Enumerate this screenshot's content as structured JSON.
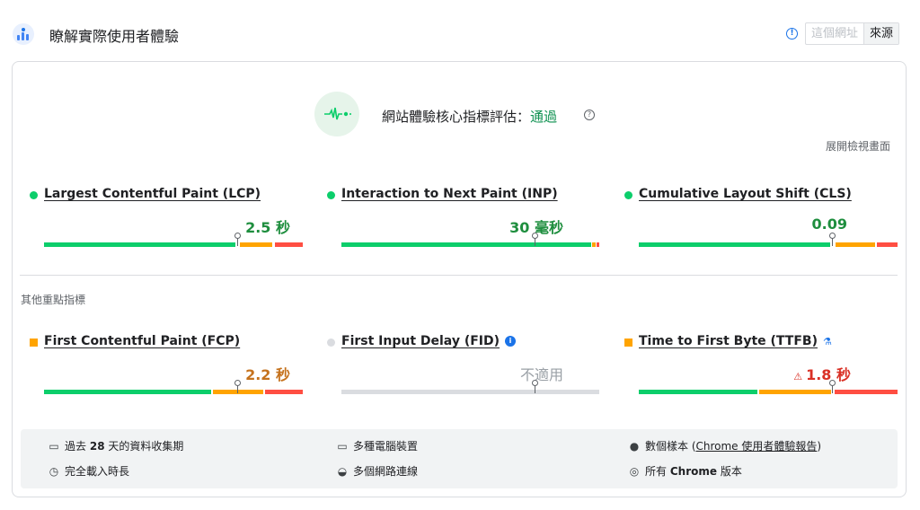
{
  "header": {
    "title": "瞭解實際使用者體驗",
    "tabs": [
      {
        "label": "這個網址",
        "active": false
      },
      {
        "label": "來源",
        "active": true
      }
    ]
  },
  "assessment": {
    "prefix": "網站體驗核心指標評估：",
    "result": "通過",
    "expand_label": "展開檢視畫面"
  },
  "core_metrics": [
    {
      "name": "Largest Contentful Paint (LCP)",
      "value": "2.5 秒",
      "status": "good",
      "good_pct": 75,
      "ni_pct": 13,
      "poor_pct": 12,
      "marker_pct": 75
    },
    {
      "name": "Interaction to Next Paint (INP)",
      "value": "30 毫秒",
      "status": "good",
      "good_pct": 97,
      "ni_pct": 2,
      "poor_pct": 1,
      "marker_pct": 75
    },
    {
      "name": "Cumulative Layout Shift (CLS)",
      "value": "0.09",
      "status": "good",
      "good_pct": 76,
      "ni_pct": 16,
      "poor_pct": 8,
      "marker_pct": 75
    }
  ],
  "other_label": "其他重點指標",
  "other_metrics": [
    {
      "name": "First Contentful Paint (FCP)",
      "value": "2.2 秒",
      "status": "ni",
      "good_pct": 65,
      "ni_pct": 20,
      "poor_pct": 15,
      "marker_pct": 75
    },
    {
      "name": "First Input Delay (FID)",
      "value": "不適用",
      "status": "na",
      "marker_pct": 75
    },
    {
      "name": "Time to First Byte (TTFB)",
      "value": "1.8 秒",
      "status": "poor",
      "good_pct": 46,
      "ni_pct": 29,
      "poor_pct": 25,
      "marker_pct": 75
    }
  ],
  "footer": {
    "period_prefix": "過去",
    "period_days": "28",
    "period_suffix": "天的資料收集期",
    "devices": "多種電腦裝置",
    "samples_prefix": "數個樣本 (",
    "samples_link": "Chrome 使用者體驗報告",
    "samples_suffix": ")",
    "load": "完全載入時長",
    "network": "多個網路連線",
    "versions_prefix": "所有",
    "versions_bold": "Chrome",
    "versions_suffix": "版本"
  },
  "icons": {
    "logo": "crux-logo-icon",
    "info": "info-icon",
    "assessment": "pulse-icon",
    "help": "help-icon",
    "calendar": "calendar-icon",
    "devices": "devices-icon",
    "samples": "samples-icon",
    "timer": "timer-icon",
    "network": "wifi-icon",
    "chrome": "chrome-icon"
  },
  "colors": {
    "good": "#0cce6b",
    "needs_improvement": "#ffa400",
    "poor": "#ff4e42",
    "pass_text": "#0d904f",
    "accent": "#1a73e8"
  }
}
